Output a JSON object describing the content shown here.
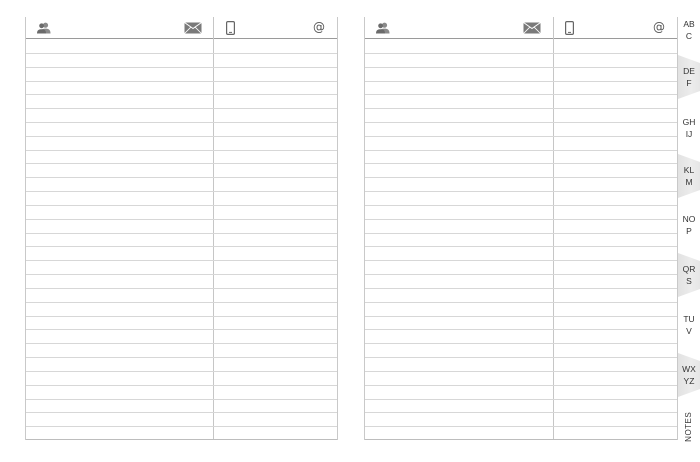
{
  "left_page": {
    "header": {
      "contact_icon": "person-icon",
      "mail_icon": "envelope-icon",
      "phone_icon": "mobile-phone-icon",
      "email_symbol": "@"
    },
    "row_count": 29
  },
  "right_page": {
    "header": {
      "contact_icon": "person-icon",
      "mail_icon": "envelope-icon",
      "phone_icon": "mobile-phone-icon",
      "email_symbol": "@"
    },
    "row_count": 29
  },
  "index_tabs": [
    {
      "label": "AB\nC",
      "shaded": false
    },
    {
      "label": "DE\nF",
      "shaded": true
    },
    {
      "label": "GH\nIJ",
      "shaded": false
    },
    {
      "label": "KL\nM",
      "shaded": true
    },
    {
      "label": "NO\nP",
      "shaded": false
    },
    {
      "label": "QR\nS",
      "shaded": true
    },
    {
      "label": "TU\nV",
      "shaded": false
    },
    {
      "label": "WX\nYZ",
      "shaded": true
    },
    {
      "label": "NOTES",
      "shaded": false
    }
  ],
  "colors": {
    "rule": "#d7d7d7",
    "header_rule": "#9a9a9a",
    "tab_fill": "#e6e6e6",
    "icon": "#666666"
  }
}
